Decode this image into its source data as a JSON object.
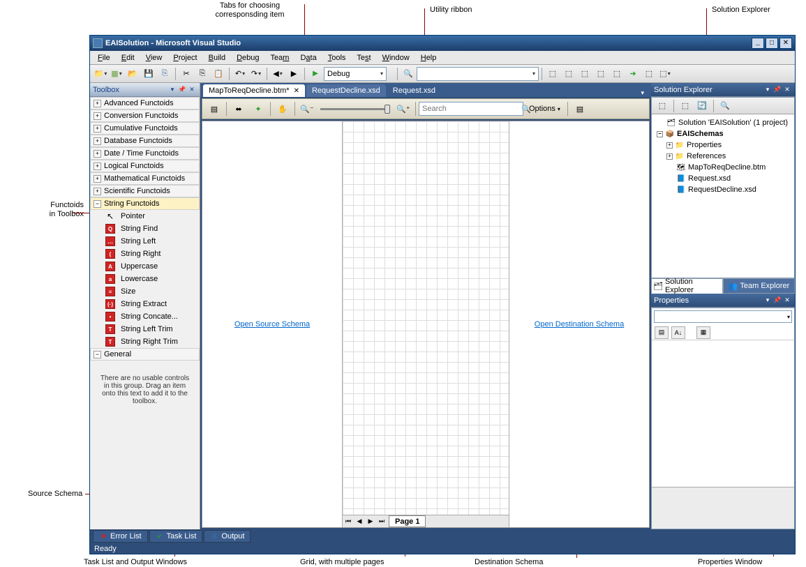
{
  "annotations": {
    "tabs": "Tabs for choosing\ncorresponsding item",
    "ribbon": "Utility ribbon",
    "solexp": "Solution Explorer",
    "functoids": "Functoids\nin Toolbox",
    "source": "Source Schema",
    "bottom": "Task List and Output Windows",
    "grid": "Grid, with multiple pages",
    "dest": "Destination Schema",
    "props": "Properties Window"
  },
  "window": {
    "title": "EAISolution - Microsoft Visual Studio"
  },
  "menu": [
    "File",
    "Edit",
    "View",
    "Project",
    "Build",
    "Debug",
    "Team",
    "Data",
    "Tools",
    "Test",
    "Window",
    "Help"
  ],
  "toolbar": {
    "config": "Debug"
  },
  "toolbox": {
    "title": "Toolbox",
    "categories": [
      {
        "label": "Advanced Functoids",
        "expanded": false
      },
      {
        "label": "Conversion Functoids",
        "expanded": false
      },
      {
        "label": "Cumulative Functoids",
        "expanded": false
      },
      {
        "label": "Database Functoids",
        "expanded": false
      },
      {
        "label": "Date / Time Functoids",
        "expanded": false
      },
      {
        "label": "Logical Functoids",
        "expanded": false
      },
      {
        "label": "Mathematical Functoids",
        "expanded": false
      },
      {
        "label": "Scientific Functoids",
        "expanded": false
      },
      {
        "label": "String Functoids",
        "expanded": true
      }
    ],
    "string_items": [
      {
        "label": "Pointer",
        "icon": "pointer"
      },
      {
        "label": "String Find",
        "icon": "Q"
      },
      {
        "label": "String Left",
        "icon": "…"
      },
      {
        "label": "String Right",
        "icon": "("
      },
      {
        "label": "Uppercase",
        "icon": "A"
      },
      {
        "label": "Lowercase",
        "icon": "a"
      },
      {
        "label": "Size",
        "icon": "≡"
      },
      {
        "label": "String Extract",
        "icon": "(·)"
      },
      {
        "label": "String Concate...",
        "icon": "•"
      },
      {
        "label": "String Left Trim",
        "icon": "T"
      },
      {
        "label": "String Right Trim",
        "icon": "T"
      }
    ],
    "general_label": "General",
    "general_empty": "There are no usable controls in this group. Drag an item onto this text to add it to the toolbox."
  },
  "editor": {
    "tabs": [
      {
        "label": "MapToReqDecline.btm*",
        "active": true
      },
      {
        "label": "RequestDecline.xsd",
        "active": false
      },
      {
        "label": "Request.xsd",
        "active": false
      }
    ],
    "search_placeholder": "Search",
    "options_label": "Options",
    "open_source": "Open Source Schema",
    "open_dest": "Open Destination Schema",
    "page_label": "Page 1"
  },
  "solution_explorer": {
    "title": "Solution Explorer",
    "root": "Solution 'EAISolution' (1 project)",
    "project": "EAISchemas",
    "children": [
      {
        "label": "Properties",
        "icon": "folder",
        "expandable": true
      },
      {
        "label": "References",
        "icon": "folder",
        "expandable": true
      },
      {
        "label": "MapToReqDecline.btm",
        "icon": "map",
        "expandable": false
      },
      {
        "label": "Request.xsd",
        "icon": "xsd",
        "expandable": false
      },
      {
        "label": "RequestDecline.xsd",
        "icon": "xsd",
        "expandable": false
      }
    ],
    "tabs": [
      "Solution Explorer",
      "Team Explorer"
    ]
  },
  "properties": {
    "title": "Properties"
  },
  "bottom_tabs": [
    {
      "label": "Error List",
      "icon": "✖"
    },
    {
      "label": "Task List",
      "icon": "✔"
    },
    {
      "label": "Output",
      "icon": "≣"
    }
  ],
  "status": "Ready"
}
